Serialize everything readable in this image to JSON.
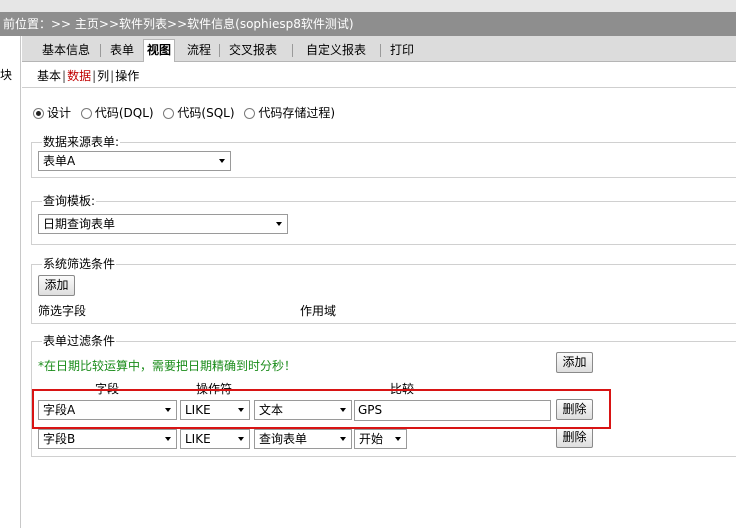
{
  "breadcrumb": "前位置：>> 主页>>软件列表>>软件信息(sophiesp8软件测试)",
  "left_panel": {
    "text": "块"
  },
  "tabs": [
    {
      "label": "基本信息",
      "active": false
    },
    {
      "label": "表单",
      "active": false
    },
    {
      "label": "视图",
      "active": true
    },
    {
      "label": "流程",
      "active": false
    },
    {
      "label": "交叉报表",
      "active": false
    },
    {
      "label": "自定义报表",
      "active": false
    },
    {
      "label": "打印",
      "active": false
    }
  ],
  "subtabs": [
    {
      "label": "基本",
      "current": false
    },
    {
      "label": "数据",
      "current": true
    },
    {
      "label": "列",
      "current": false
    },
    {
      "label": "操作",
      "current": false
    }
  ],
  "mode": {
    "options": [
      "设计",
      "代码(DQL)",
      "代码(SQL)",
      "代码存储过程)"
    ],
    "selected": "设计"
  },
  "data_source": {
    "legend": "数据来源表单:",
    "value": "表单A"
  },
  "query_template": {
    "legend": "查询模板:",
    "value": "日期查询表单"
  },
  "system_filter": {
    "legend": "系统筛选条件",
    "add_label": "添加",
    "col_field": "筛选字段",
    "col_scope": "作用域"
  },
  "form_filter": {
    "legend": "表单过滤条件",
    "note": "*在日期比较运算中，需要把日期精确到时分秒！",
    "add_label": "添加",
    "headers": {
      "field": "字段",
      "operator": "操作符",
      "compare": "比较"
    },
    "rows": [
      {
        "field": "字段A",
        "operator": "LIKE",
        "type": "文本",
        "value": "GPS",
        "delete_label": "删除"
      },
      {
        "field": "字段B",
        "operator": "LIKE",
        "type": "查询表单",
        "value": "开始",
        "delete_label": "删除"
      }
    ]
  },
  "colors": {
    "highlight": "#d81414",
    "note": "#1a8c1a",
    "current_subtab": "#c00000",
    "breadcrumb_bg": "#8e8e8e"
  }
}
